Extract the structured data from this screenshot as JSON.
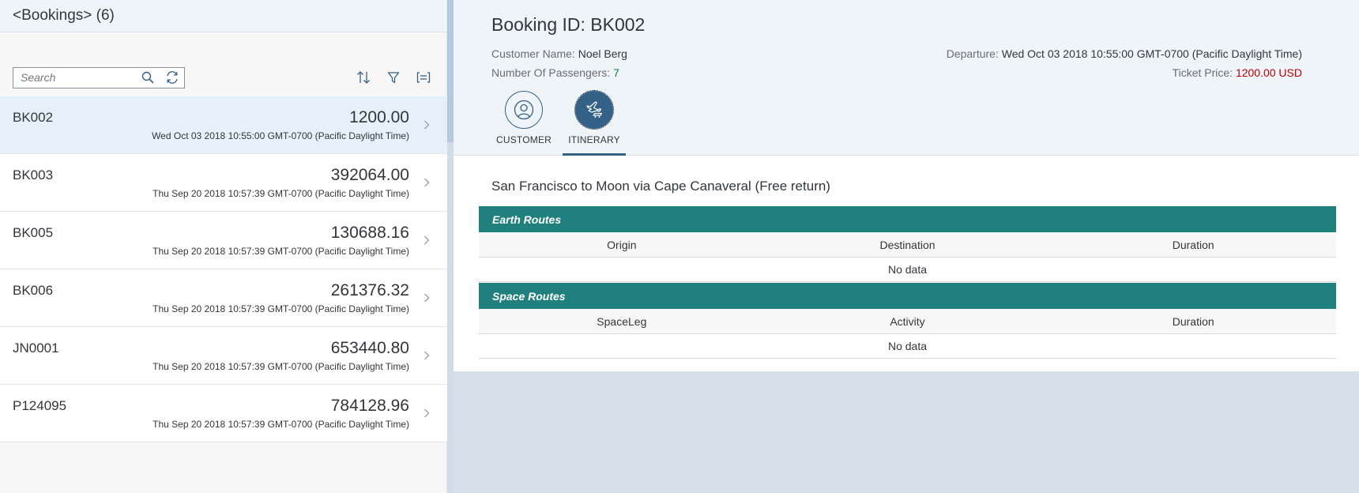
{
  "master": {
    "title": "<Bookings> (6)",
    "search": {
      "placeholder": "Search",
      "value": ""
    },
    "items": [
      {
        "id": "BK002",
        "price": "1200.00",
        "date": "Wed Oct 03 2018 10:55:00 GMT-0700 (Pacific Daylight Time)",
        "selected": true
      },
      {
        "id": "BK003",
        "price": "392064.00",
        "date": "Thu Sep 20 2018 10:57:39 GMT-0700 (Pacific Daylight Time)",
        "selected": false
      },
      {
        "id": "BK005",
        "price": "130688.16",
        "date": "Thu Sep 20 2018 10:57:39 GMT-0700 (Pacific Daylight Time)",
        "selected": false
      },
      {
        "id": "BK006",
        "price": "261376.32",
        "date": "Thu Sep 20 2018 10:57:39 GMT-0700 (Pacific Daylight Time)",
        "selected": false
      },
      {
        "id": "JN0001",
        "price": "653440.80",
        "date": "Thu Sep 20 2018 10:57:39 GMT-0700 (Pacific Daylight Time)",
        "selected": false
      },
      {
        "id": "P124095",
        "price": "784128.96",
        "date": "Thu Sep 20 2018 10:57:39 GMT-0700 (Pacific Daylight Time)",
        "selected": false
      }
    ]
  },
  "detail": {
    "title": "Booking ID: BK002",
    "customer_label": "Customer Name: ",
    "customer_value": "Noel Berg",
    "passengers_label": "Number Of Passengers: ",
    "passengers_value": "7",
    "departure_label": "Departure: ",
    "departure_value": "Wed Oct 03 2018 10:55:00 GMT-0700 (Pacific Daylight Time)",
    "price_label": "Ticket Price: ",
    "price_value": "1200.00 USD",
    "tabs": [
      {
        "label": "CUSTOMER",
        "icon": "customer-icon",
        "selected": false
      },
      {
        "label": "ITINERARY",
        "icon": "flight-icon",
        "selected": true
      }
    ],
    "itinerary": {
      "title": "San Francisco to Moon via Cape Canaveral (Free return)",
      "earth": {
        "heading": "Earth Routes",
        "columns": [
          "Origin",
          "Destination",
          "Duration"
        ],
        "no_data": "No data"
      },
      "space": {
        "heading": "Space Routes",
        "columns": [
          "SpaceLeg",
          "Activity",
          "Duration"
        ],
        "no_data": "No data"
      }
    }
  },
  "colors": {
    "accent": "#346187",
    "table_header": "#20807e",
    "positive": "#107e3e",
    "negative": "#bb0000",
    "selection": "#e5f0fa"
  }
}
